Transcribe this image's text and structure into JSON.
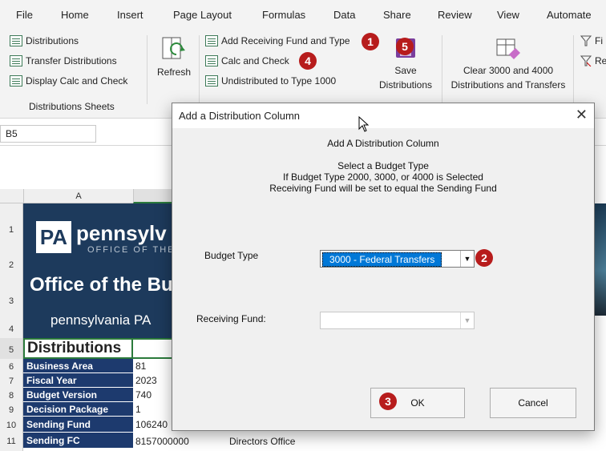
{
  "ribbon": {
    "tabs": [
      "File",
      "Home",
      "Insert",
      "Page Layout",
      "Formulas",
      "Data",
      "Share",
      "Review",
      "View",
      "Automate"
    ],
    "distributions_group": {
      "items": [
        "Distributions",
        "Transfer Distributions",
        "Display Calc and Check"
      ],
      "label": "Distributions Sheets"
    },
    "refresh_label": "Refresh",
    "actions": [
      "Add Receiving Fund and Type",
      "Calc and Check",
      "Undistributed to Type 1000"
    ],
    "save_label_1": "Save",
    "save_label_2": "Distributions",
    "clear_label_1": "Clear 3000 and 4000",
    "clear_label_2": "Distributions and Transfers",
    "partial_right_1": "Fi",
    "partial_right_2": "Re"
  },
  "badges": [
    "1",
    "2",
    "3",
    "4",
    "5"
  ],
  "name_box": "B5",
  "sheet": {
    "column_a": "A",
    "row_numbers": [
      "1",
      "2",
      "3",
      "4",
      "5",
      "6",
      "7",
      "8",
      "9",
      "10",
      "11"
    ],
    "banner": {
      "logo_mark": "PA",
      "name": "pennsylv",
      "subtitle": "OFFICE OF THE",
      "office": "Office of the Bu",
      "footer": "pennsylvania PA"
    },
    "title": "Distributions",
    "rows": [
      {
        "label": "Business Area",
        "value": "81"
      },
      {
        "label": "Fiscal Year",
        "value": "2023"
      },
      {
        "label": "Budget Version",
        "value": "740"
      },
      {
        "label": "Decision Package",
        "value": "1"
      },
      {
        "label": "Sending Fund",
        "value": "106240"
      },
      {
        "label": "Sending FC",
        "value": "8157000000",
        "extra": "Directors Office"
      }
    ]
  },
  "dialog": {
    "title": "Add a Distribution Column",
    "heading": "Add A Distribution Column",
    "instructions": [
      "Select a Budget Type",
      "If Budget Type 2000, 3000, or 4000 is Selected",
      "Receiving Fund will be set to equal the Sending Fund"
    ],
    "budget_type_label": "Budget Type",
    "budget_type_value": "3000 - Federal Transfers",
    "receiving_fund_label": "Receiving Fund:",
    "receiving_fund_value": "",
    "ok_label": "OK",
    "cancel_label": "Cancel"
  },
  "colors": {
    "badge": "#b71c1c",
    "banner": "#1d3a5c",
    "label_cell": "#1d3a6e",
    "selection": "#0078d7"
  },
  "icons": [
    "table-icon",
    "refresh-icon",
    "save-icon",
    "clear-icon",
    "filter-icon",
    "dropdown-arrow-icon",
    "close-icon",
    "mouse-cursor-icon"
  ]
}
